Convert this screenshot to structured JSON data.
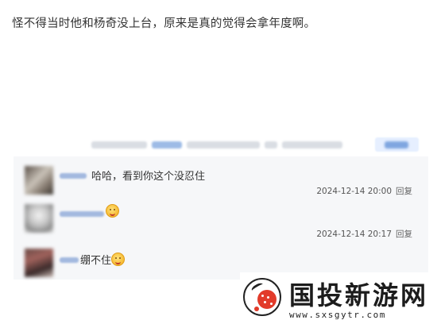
{
  "post": {
    "text": "怪不得当时他和杨奇没上台，原来是真的觉得会拿年度啊。"
  },
  "comments": [
    {
      "text": "哈哈，看到你这个没忍住",
      "date": "2024-12-14 20:00",
      "reply_label": "回复"
    },
    {
      "text": "",
      "emoji": "grinning-emoji",
      "date": "2024-12-14 20:17",
      "reply_label": "回复"
    },
    {
      "text": "绷不住",
      "emoji": "grinning-emoji"
    }
  ],
  "watermark": {
    "title": "国投新游网",
    "url": "www.sxsgytr.com",
    "logo_icon": "ladybug-logo"
  },
  "colors": {
    "background": "#ffffff",
    "comment_panel": "#f6f7f9",
    "text": "#333333",
    "username_blur": "#a3b9df",
    "logo_red": "#e23b2a"
  }
}
